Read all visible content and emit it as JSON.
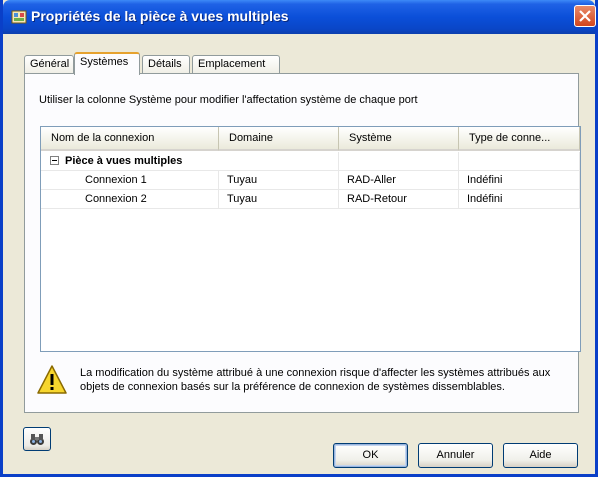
{
  "window": {
    "title": "Propriétés de la pièce à vues multiples"
  },
  "tabs": [
    {
      "label": "Général",
      "active": false
    },
    {
      "label": "Systèmes",
      "active": true
    },
    {
      "label": "Détails",
      "active": false
    },
    {
      "label": "Emplacement",
      "active": false
    }
  ],
  "panel": {
    "instruction": "Utiliser la colonne Système pour modifier l'affectation système de chaque port"
  },
  "table": {
    "columns": [
      "Nom de la connexion",
      "Domaine",
      "Système",
      "Type de conne..."
    ],
    "group": {
      "label": "Pièce à vues multiples",
      "expanded": true
    },
    "rows": [
      [
        "Connexion 1",
        "Tuyau",
        "RAD-Aller",
        "Indéfini"
      ],
      [
        "Connexion 2",
        "Tuyau",
        "RAD-Retour",
        "Indéfini"
      ]
    ]
  },
  "warning": {
    "icon": "warning-triangle-icon",
    "text": "La modification du système attribué à une connexion risque d'affecter les systèmes attribués aux objets de connexion basés sur la préférence de connexion de systèmes dissemblables."
  },
  "footer": {
    "help_icon": "binoculars-icon",
    "ok_label": "OK",
    "cancel_label": "Annuler",
    "help_label": "Aide"
  },
  "colors": {
    "title_bar": "#0b4fd9",
    "dialog_bg": "#ece9d8",
    "active_tab_accent": "#e6a22e",
    "close_button": "#d4461d"
  }
}
